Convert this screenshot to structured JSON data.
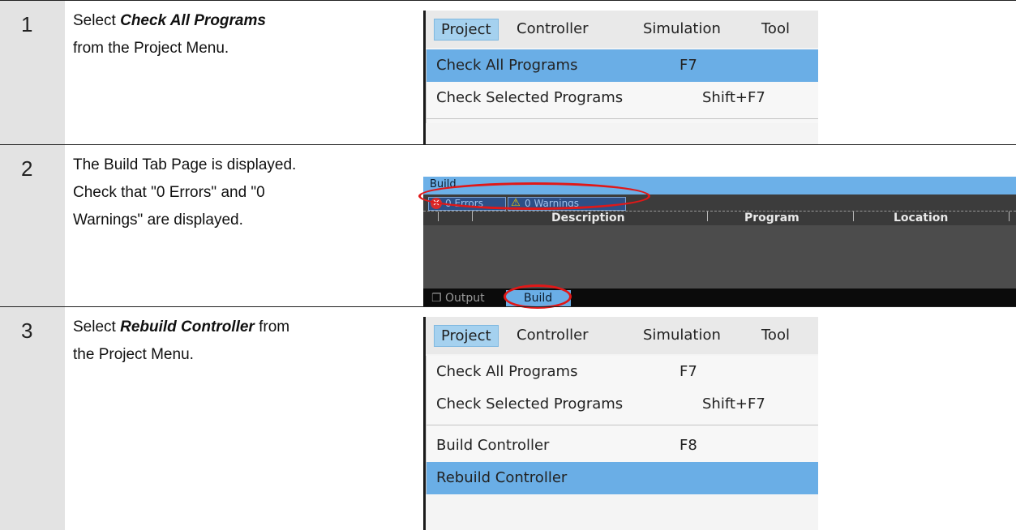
{
  "steps": [
    {
      "number": "1",
      "line1_prefix": "Select ",
      "line1_emph": "Check All Programs",
      "line2": "from the Project Menu."
    },
    {
      "number": "2",
      "line1": "The Build Tab Page is displayed.",
      "line2": "Check that \"0 Errors\" and \"0",
      "line3": "Warnings\" are displayed."
    },
    {
      "number": "3",
      "line1_prefix": "Select ",
      "line1_emph": "Rebuild Controller",
      "line1_suffix": " from",
      "line2": "the Project Menu."
    }
  ],
  "menubar": {
    "project": "Project",
    "controller": "Controller",
    "simulation": "Simulation",
    "tools": "Tool"
  },
  "menu": {
    "check_all": "Check All Programs",
    "check_all_key": "F7",
    "check_selected": "Check Selected Programs",
    "check_selected_key": "Shift+F7",
    "build_controller": "Build Controller",
    "build_controller_key": "F8",
    "rebuild_controller": "Rebuild Controller"
  },
  "build_pane": {
    "title": "Build",
    "errors_chip": "0  Errors",
    "warnings_chip": "0  Warnings",
    "columns": [
      "Description",
      "Program",
      "Location"
    ],
    "tab_output": "Output",
    "tab_build": "Build"
  },
  "colors": {
    "highlight": "#6aaee6",
    "annotation_ring": "#e01818",
    "step_column": "#e3e3e3"
  }
}
